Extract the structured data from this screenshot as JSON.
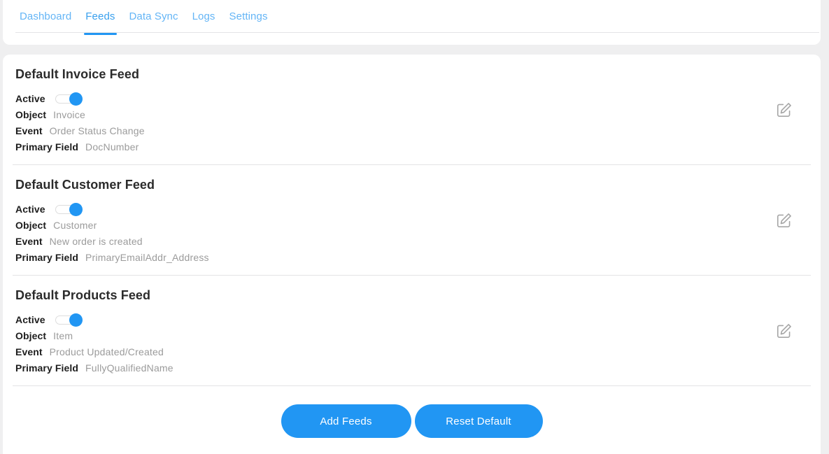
{
  "nav": {
    "tabs": [
      {
        "label": "Dashboard",
        "active": false
      },
      {
        "label": "Feeds",
        "active": true
      },
      {
        "label": "Data Sync",
        "active": false
      },
      {
        "label": "Logs",
        "active": false
      },
      {
        "label": "Settings",
        "active": false
      }
    ]
  },
  "labels": {
    "active": "Active",
    "object": "Object",
    "event": "Event",
    "primary_field": "Primary Field"
  },
  "feeds": [
    {
      "title": "Default Invoice Feed",
      "active": true,
      "object": "Invoice",
      "event": "Order Status Change",
      "primary_field": "DocNumber",
      "edit_icon": "edit-pencil-icon"
    },
    {
      "title": "Default Customer Feed",
      "active": true,
      "object": "Customer",
      "event": "New order is created",
      "primary_field": "PrimaryEmailAddr_Address",
      "edit_icon": "edit-pencil-icon"
    },
    {
      "title": "Default Products Feed",
      "active": true,
      "object": "Item",
      "event": "Product Updated/Created",
      "primary_field": "FullyQualifiedName",
      "edit_icon": "edit-pencil-icon"
    }
  ],
  "footer": {
    "add_feeds_label": "Add Feeds",
    "reset_default_label": "Reset Default"
  },
  "colors": {
    "accent": "#2196f3",
    "tab_inactive": "#64b5f6",
    "page_background": "#efeff0",
    "panel_background": "#ffffff",
    "value_text": "#9b9b9b",
    "label_text": "#1d1d1d",
    "divider": "#e3e3e5"
  }
}
